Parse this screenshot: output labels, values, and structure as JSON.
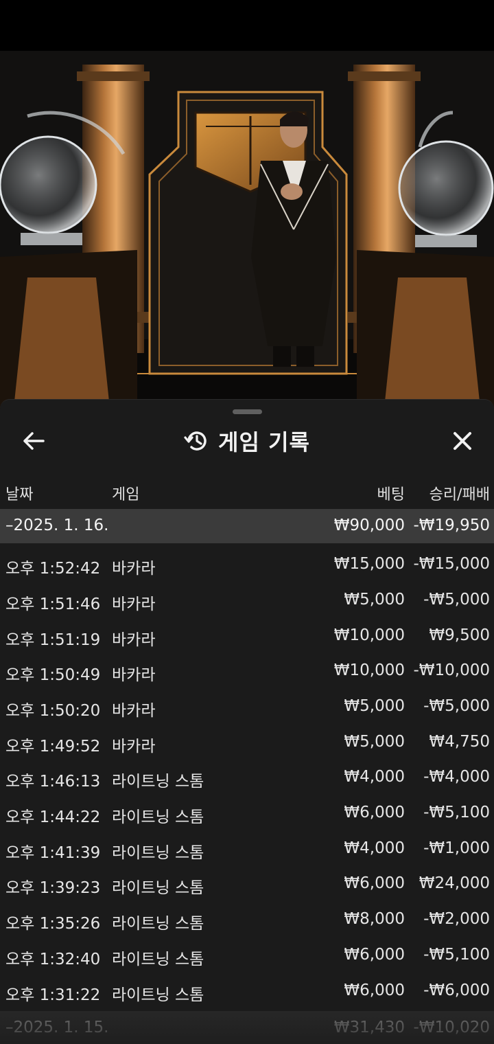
{
  "colors": {
    "sheet_bg": "#1b1b1b",
    "day_row_bg": "#3b3b3b",
    "accent_gold": "#c98a3c"
  },
  "header": {
    "back_icon": "arrow-left-icon",
    "history_icon": "history-clock-icon",
    "title": "게임 기록",
    "close_icon": "close-icon"
  },
  "table": {
    "columns": {
      "date": "날짜",
      "game": "게임",
      "bet": "베팅",
      "win_loss": "승리/패배"
    },
    "day_1": {
      "date": "–2025. 1. 16.",
      "bet": "₩90,000",
      "win_loss": "-₩19,950"
    },
    "rows": [
      {
        "time": "오후 1:52:42",
        "game": "바카라",
        "bet": "₩15,000",
        "win_loss": "-₩15,000"
      },
      {
        "time": "오후 1:51:46",
        "game": "바카라",
        "bet": "₩5,000",
        "win_loss": "-₩5,000"
      },
      {
        "time": "오후 1:51:19",
        "game": "바카라",
        "bet": "₩10,000",
        "win_loss": "₩9,500"
      },
      {
        "time": "오후 1:50:49",
        "game": "바카라",
        "bet": "₩10,000",
        "win_loss": "-₩10,000"
      },
      {
        "time": "오후 1:50:20",
        "game": "바카라",
        "bet": "₩5,000",
        "win_loss": "-₩5,000"
      },
      {
        "time": "오후 1:49:52",
        "game": "바카라",
        "bet": "₩5,000",
        "win_loss": "₩4,750"
      },
      {
        "time": "오후 1:46:13",
        "game": "라이트닝 스톰",
        "bet": "₩4,000",
        "win_loss": "-₩4,000"
      },
      {
        "time": "오후 1:44:22",
        "game": "라이트닝 스톰",
        "bet": "₩6,000",
        "win_loss": "-₩5,100"
      },
      {
        "time": "오후 1:41:39",
        "game": "라이트닝 스톰",
        "bet": "₩4,000",
        "win_loss": "-₩1,000"
      },
      {
        "time": "오후 1:39:23",
        "game": "라이트닝 스톰",
        "bet": "₩6,000",
        "win_loss": "₩24,000"
      },
      {
        "time": "오후 1:35:26",
        "game": "라이트닝 스톰",
        "bet": "₩8,000",
        "win_loss": "-₩2,000"
      },
      {
        "time": "오후 1:32:40",
        "game": "라이트닝 스톰",
        "bet": "₩6,000",
        "win_loss": "-₩5,100"
      },
      {
        "time": "오후 1:31:22",
        "game": "라이트닝 스톰",
        "bet": "₩6,000",
        "win_loss": "-₩6,000"
      }
    ],
    "day_2": {
      "date": "–2025. 1. 15.",
      "bet": "₩31,430",
      "win_loss": "-₩10,020"
    }
  }
}
